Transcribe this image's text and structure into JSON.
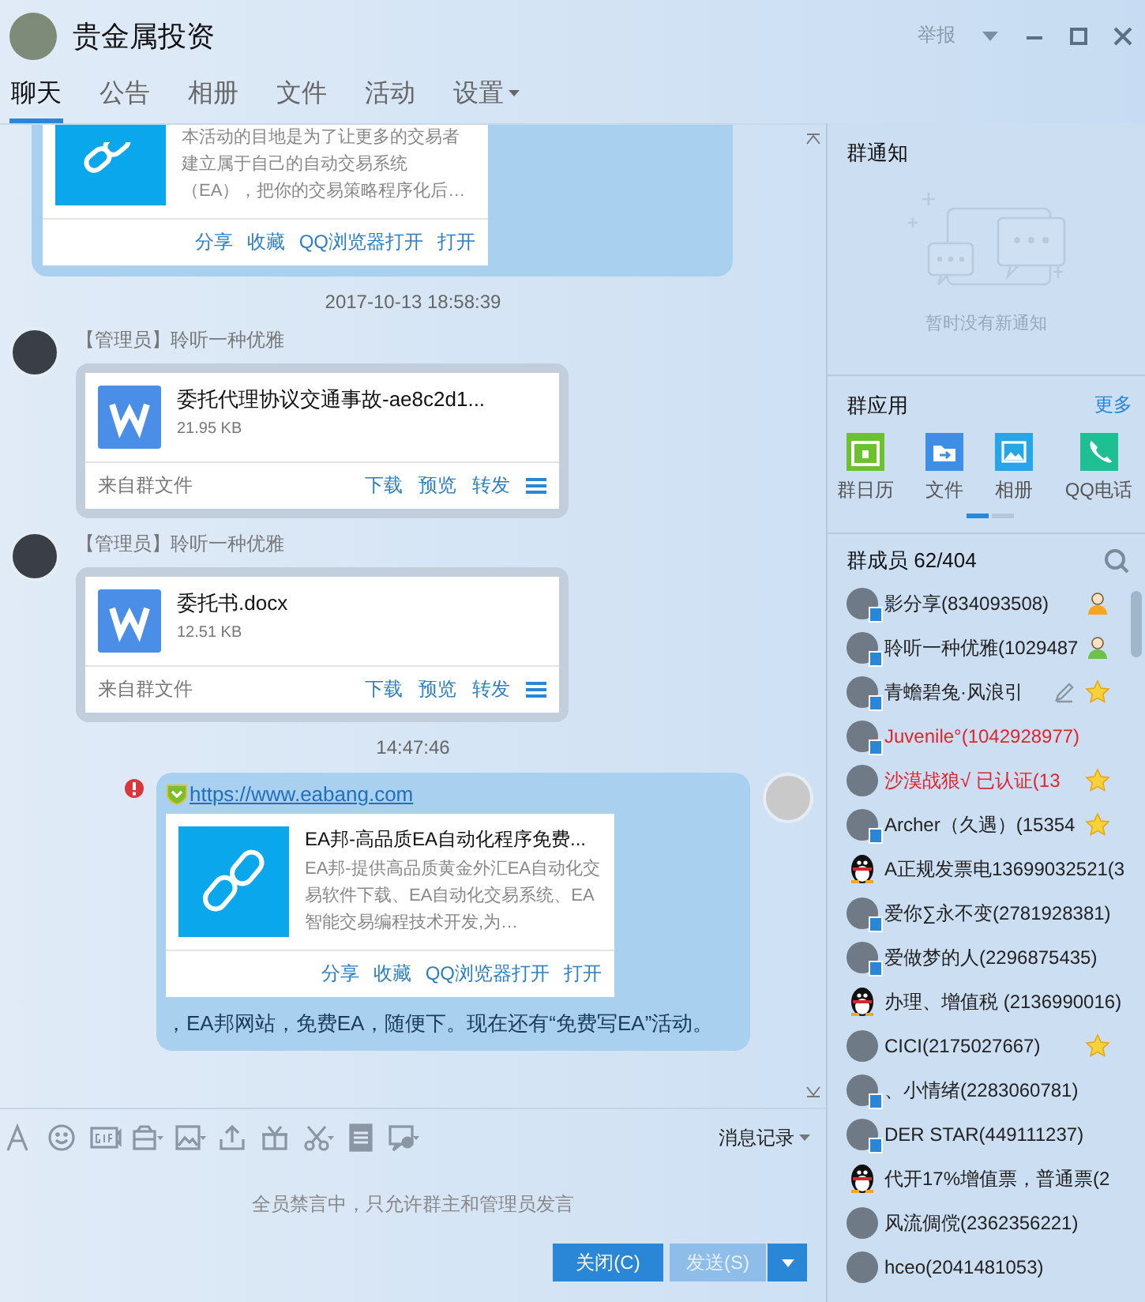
{
  "window": {
    "title": "贵金属投资",
    "report": "举报"
  },
  "tabs": [
    {
      "label": "聊天",
      "selected": true,
      "dropdown": false
    },
    {
      "label": "公告",
      "selected": false,
      "dropdown": false
    },
    {
      "label": "相册",
      "selected": false,
      "dropdown": false
    },
    {
      "label": "文件",
      "selected": false,
      "dropdown": false
    },
    {
      "label": "活动",
      "selected": false,
      "dropdown": false
    },
    {
      "label": "设置",
      "selected": false,
      "dropdown": true
    }
  ],
  "messages": [
    {
      "kind": "partial_link",
      "desc": "本活动的目地是为了让更多的交易者建立属于自己的自动交易系统（EA），把你的交易策略程序化后…",
      "actions": [
        "分享",
        "收藏",
        "QQ浏览器打开",
        "打开"
      ]
    },
    {
      "kind": "time",
      "text": "2017-10-13 18:58:39"
    },
    {
      "kind": "file",
      "sender": "【管理员】聆听一种优雅",
      "name": "委托代理协议交通事故-ae8c2d1...",
      "size": "21.95 KB",
      "source": "来自群文件",
      "actions": [
        "下载",
        "预览",
        "转发"
      ]
    },
    {
      "kind": "file",
      "sender": "【管理员】聆听一种优雅",
      "name": "委托书.docx",
      "size": "12.51 KB",
      "source": "来自群文件",
      "actions": [
        "下载",
        "预览",
        "转发"
      ]
    },
    {
      "kind": "time",
      "text": "14:47:46"
    },
    {
      "kind": "link",
      "error": true,
      "url": "https://www.eabang.com",
      "title": "EA邦-高品质EA自动化程序免费...",
      "desc": "EA邦-提供高品质黄金外汇EA自动化交易软件下载、EA自动化交易系统、EA智能交易编程技术开发,为…",
      "actions": [
        "分享",
        "收藏",
        "QQ浏览器打开",
        "打开"
      ],
      "text": "，EA邦网站，免费EA，随便下。现在还有“免费写EA”活动。"
    }
  ],
  "history": "消息记录",
  "mute_notice": "全员禁言中，只允许群主和管理员发言",
  "buttons": {
    "close": "关闭(C)",
    "send": "发送(S)",
    "send_disabled": true
  },
  "notice": {
    "title": "群通知",
    "empty": "暂时没有新通知"
  },
  "apps": {
    "title": "群应用",
    "more": "更多",
    "items": [
      {
        "label": "群日历",
        "kind": "calendar"
      },
      {
        "label": "文件",
        "kind": "folder"
      },
      {
        "label": "相册",
        "kind": "photo"
      },
      {
        "label": "QQ电话",
        "kind": "phone"
      }
    ],
    "pages": [
      {
        "selected": true
      },
      {
        "selected": false
      }
    ]
  },
  "members": {
    "title": "群成员 62/404",
    "items": [
      {
        "name": "影分享(834093508)",
        "kind": "photo",
        "device": true,
        "owner": true,
        "admin": false,
        "editable": false,
        "starred": false,
        "color": "#222222"
      },
      {
        "name": "聆听一种优雅(1029487",
        "kind": "photo",
        "device": true,
        "owner": false,
        "admin": true,
        "editable": false,
        "starred": false,
        "color": "#222222"
      },
      {
        "name": "青蟾碧兔·风浪引",
        "kind": "photo",
        "device": true,
        "owner": false,
        "admin": false,
        "editable": true,
        "starred": true,
        "color": "#222222"
      },
      {
        "name": "Juvenile°(1042928977)",
        "kind": "photo",
        "device": true,
        "owner": false,
        "admin": false,
        "editable": false,
        "starred": false,
        "color": "#e0252d"
      },
      {
        "name": "沙漠战狼√  已认证(13",
        "kind": "photo",
        "device": false,
        "owner": false,
        "admin": false,
        "editable": false,
        "starred": true,
        "color": "#e0252d"
      },
      {
        "name": "Archer（久遇）(15354",
        "kind": "photo",
        "device": true,
        "owner": false,
        "admin": false,
        "editable": false,
        "starred": true,
        "color": "#222222"
      },
      {
        "name": "A正规发票电13699032521(3",
        "kind": "penguin",
        "device": false,
        "owner": false,
        "admin": false,
        "editable": false,
        "starred": false,
        "color": "#222222"
      },
      {
        "name": "爱你∑永不变(2781928381)",
        "kind": "photo",
        "device": true,
        "owner": false,
        "admin": false,
        "editable": false,
        "starred": false,
        "color": "#222222"
      },
      {
        "name": "爱做梦的人(2296875435)",
        "kind": "photo",
        "device": true,
        "owner": false,
        "admin": false,
        "editable": false,
        "starred": false,
        "color": "#222222"
      },
      {
        "name": "办理、增值税 (2136990016)",
        "kind": "penguin",
        "device": false,
        "owner": false,
        "admin": false,
        "editable": false,
        "starred": false,
        "color": "#222222"
      },
      {
        "name": "CICI(2175027667)",
        "kind": "photo",
        "device": false,
        "owner": false,
        "admin": false,
        "editable": false,
        "starred": true,
        "color": "#222222"
      },
      {
        "name": "、小情绪(2283060781)",
        "kind": "photo",
        "device": true,
        "owner": false,
        "admin": false,
        "editable": false,
        "starred": false,
        "color": "#222222"
      },
      {
        "name": "DER STAR(449111237)",
        "kind": "photo",
        "device": true,
        "owner": false,
        "admin": false,
        "editable": false,
        "starred": false,
        "color": "#222222"
      },
      {
        "name": "代开17%增值票，普通票(2",
        "kind": "penguin",
        "device": false,
        "owner": false,
        "admin": false,
        "editable": false,
        "starred": false,
        "color": "#222222"
      },
      {
        "name": "风流倜傥(2362356221)",
        "kind": "photo",
        "device": false,
        "owner": false,
        "admin": false,
        "editable": false,
        "starred": false,
        "color": "#222222"
      },
      {
        "name": "hceo(2041481053)",
        "kind": "photo",
        "device": false,
        "owner": false,
        "admin": false,
        "editable": false,
        "starred": false,
        "color": "#222222"
      }
    ]
  }
}
